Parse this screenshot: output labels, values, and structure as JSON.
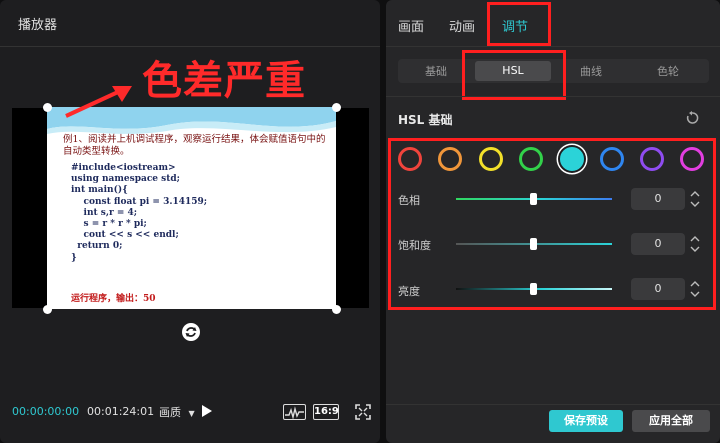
{
  "player": {
    "title": "播放器",
    "annotation": "色差严重",
    "slide": {
      "question": "例1、阅读并上机调试程序，观察运行结果，体会赋值语句中的自动类型转换。",
      "code": [
        "#include<iostream>",
        "using namespace std;",
        "int main(){",
        "    const float pi = 3.14159;",
        "    int s,r = 4;",
        "    s = r * r * pi;",
        "    cout << s << endl;",
        "  return 0;",
        "}"
      ],
      "run_result": "运行程序，输出：50"
    },
    "time_current": "00:00:00:00",
    "time_total": "00:01:24:01",
    "quality_label": "画质",
    "ratio_label": "16:9"
  },
  "adjust": {
    "tabs": [
      "画面",
      "动画",
      "调节"
    ],
    "active_tab": "调节",
    "subtabs": [
      "基础",
      "HSL",
      "曲线",
      "色轮"
    ],
    "active_subtab": "HSL",
    "section_title": "HSL 基础",
    "swatches": [
      {
        "name": "red",
        "color": "#f0443c"
      },
      {
        "name": "orange",
        "color": "#f0963a"
      },
      {
        "name": "yellow",
        "color": "#f2e02a"
      },
      {
        "name": "green",
        "color": "#32d14a"
      },
      {
        "name": "cyan",
        "color": "#2bd3d8"
      },
      {
        "name": "blue",
        "color": "#2f86f0"
      },
      {
        "name": "purple",
        "color": "#8f4cf0"
      },
      {
        "name": "magenta",
        "color": "#e23ee0"
      }
    ],
    "selected_swatch": "cyan",
    "sliders": [
      {
        "label": "色相",
        "value": "0"
      },
      {
        "label": "饱和度",
        "value": "0"
      },
      {
        "label": "亮度",
        "value": "0"
      }
    ],
    "save_preset": "保存预设",
    "apply_all": "应用全部"
  },
  "colors": {
    "accent": "#2fc8d0",
    "annotation_red": "#ff2a2a"
  }
}
